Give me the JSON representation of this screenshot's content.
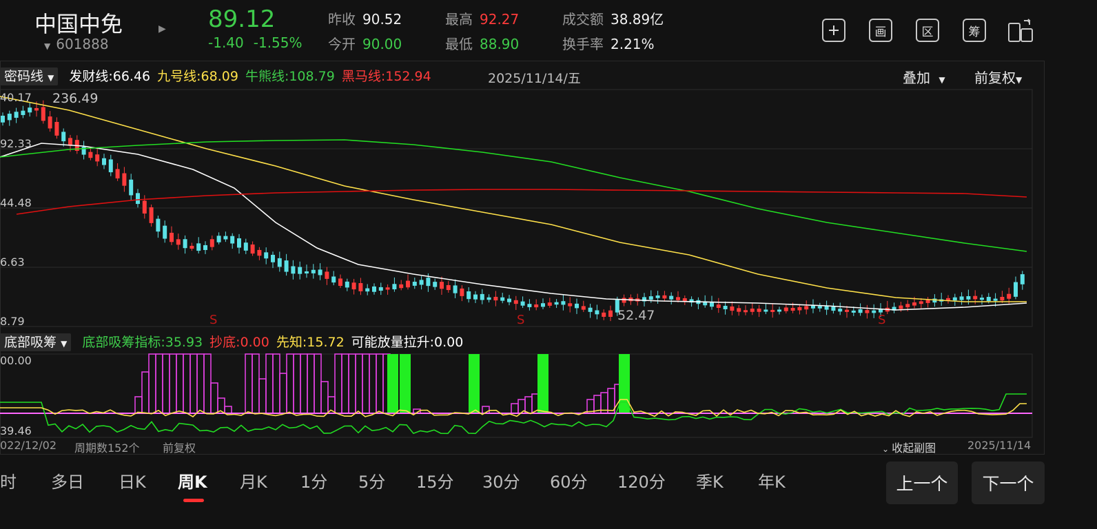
{
  "header": {
    "stock_name": "中国中免",
    "stock_code": "601888",
    "price": "89.12",
    "change": "-1.40",
    "change_pct": "-1.55%",
    "quote": {
      "prev_close_label": "昨收",
      "prev_close": "90.52",
      "open_label": "今开",
      "open": "90.00",
      "high_label": "最高",
      "high": "92.27",
      "low_label": "最低",
      "low": "88.90",
      "turnover_label": "成交额",
      "turnover": "38.89亿",
      "turnover_rate_label": "换手率",
      "turnover_rate": "2.21%"
    },
    "toolbar": {
      "add_icon": "plus-icon",
      "draw_label": "画",
      "section_label": "区",
      "chip_label": "筹",
      "switch_icon": "device-switch-icon"
    }
  },
  "main_chart": {
    "indicator_name": "密码线",
    "indicators": [
      {
        "label": "发财线:",
        "value": "66.46",
        "color": "#ffffff"
      },
      {
        "label": "九号线:",
        "value": "68.09",
        "color": "#ffe14a"
      },
      {
        "label": "牛熊线:",
        "value": "108.79",
        "color": "#3fcc4b"
      },
      {
        "label": "黑马线:",
        "value": "152.94",
        "color": "#ff3b3b"
      }
    ],
    "date": "2025/11/14/五",
    "overlay_label": "叠加",
    "adjust_label": "前复权",
    "y_labels": [
      "40.17",
      "92.33",
      "44.48",
      "6.63",
      "8.79"
    ],
    "high_annotation": "236.49",
    "low_annotation": "52.47",
    "signal_label": "S"
  },
  "sub_chart": {
    "indicator_name": "底部吸筹",
    "indicators": [
      {
        "label": "底部吸筹指标:",
        "value": "35.93",
        "color": "#3fcc4b"
      },
      {
        "label": "抄底:",
        "value": "0.00",
        "color": "#ff3b3b"
      },
      {
        "label": "先知:",
        "value": "15.72",
        "color": "#ffe14a"
      },
      {
        "label": "可能放量拉升:",
        "value": "0.00",
        "color": "#ffffff"
      }
    ],
    "y_labels": [
      "00.00",
      "39.46"
    ]
  },
  "footer": {
    "start_date": "022/12/02",
    "period_count": "周期数152个",
    "adjust": "前复权",
    "collapse_label": "收起副图",
    "end_date": "2025/11/14"
  },
  "tabs": [
    "时",
    "多日",
    "日K",
    "周K",
    "月K",
    "1分",
    "5分",
    "15分",
    "30分",
    "60分",
    "120分",
    "季K",
    "年K"
  ],
  "active_tab": "周K",
  "nav": {
    "prev": "上一个",
    "next": "下一个"
  },
  "colors": {
    "up": "#ff3b3b",
    "down": "#3fcc4b",
    "candle_down": "#5ce1e6",
    "ma_white": "#ffffff",
    "ma_yellow": "#ffe14a",
    "ma_green": "#22dd22",
    "ma_red": "#e01010",
    "magenta": "#e040e0",
    "accent": "#ff3030"
  }
}
